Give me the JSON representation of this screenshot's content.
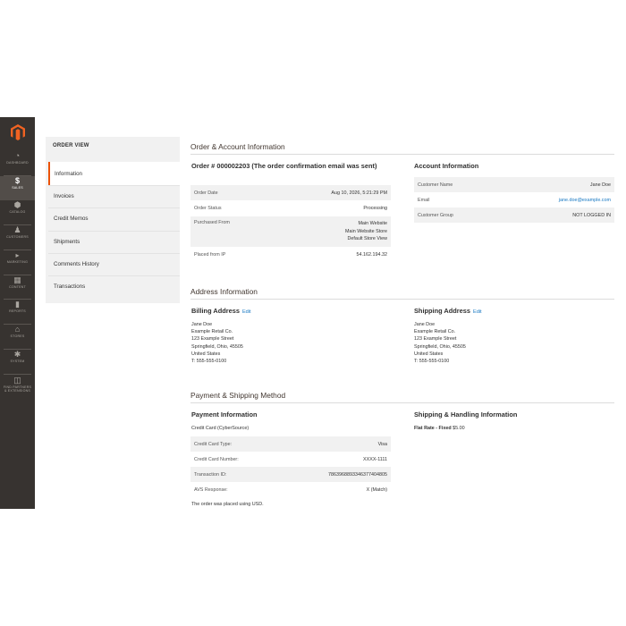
{
  "nav": {
    "items": [
      {
        "label": "DASHBOARD",
        "icon": "dashboard-icon",
        "glyph": "◔"
      },
      {
        "label": "SALES",
        "icon": "dollar-icon",
        "glyph": "$"
      },
      {
        "label": "CATALOG",
        "icon": "cube-icon",
        "glyph": "⬢"
      },
      {
        "label": "CUSTOMERS",
        "icon": "person-icon",
        "glyph": "♟"
      },
      {
        "label": "MARKETING",
        "icon": "megaphone-icon",
        "glyph": "📢"
      },
      {
        "label": "CONTENT",
        "icon": "content-icon",
        "glyph": "▦"
      },
      {
        "label": "REPORTS",
        "icon": "bar-chart-icon",
        "glyph": "▮"
      },
      {
        "label": "STORES",
        "icon": "store-icon",
        "glyph": "⌂"
      },
      {
        "label": "SYSTEM",
        "icon": "gear-icon",
        "glyph": "✱"
      },
      {
        "label": "FIND PARTNERS & EXTENSIONS",
        "icon": "partners-icon",
        "glyph": "◫"
      }
    ]
  },
  "tabs": {
    "title": "ORDER VIEW",
    "items": [
      "Information",
      "Invoices",
      "Credit Memos",
      "Shipments",
      "Comments History",
      "Transactions"
    ]
  },
  "order_account": {
    "heading": "Order & Account Information",
    "order_title": "Order # 000002203 (The order confirmation email was sent)",
    "order_rows": [
      {
        "k": "Order Date",
        "v": "Aug 10, 2026, 5:21:29 PM"
      },
      {
        "k": "Order Status",
        "v": "Processing"
      },
      {
        "k": "Purchased From",
        "v1": "Main Website",
        "v2": "Main Website Store",
        "v3": "Default Store View"
      },
      {
        "k": "Placed from IP",
        "v": "54.162.194.32"
      }
    ],
    "account_title": "Account Information",
    "account_rows": [
      {
        "k": "Customer Name",
        "v": "Jane Doe"
      },
      {
        "k": "Email",
        "v": "jane.doe@example.com"
      },
      {
        "k": "Customer Group",
        "v": "NOT LOGGED IN"
      }
    ]
  },
  "address": {
    "heading": "Address Information",
    "billing_title": "Billing Address",
    "shipping_title": "Shipping Address",
    "edit_label": "Edit",
    "billing_lines": [
      "Jane Doe",
      "Example Retail Co.",
      "123 Example Street",
      "Springfield, Ohio, 45505",
      "United States",
      "T: 555-555-0100"
    ],
    "shipping_lines": [
      "Jane Doe",
      "Example Retail Co.",
      "123 Example Street",
      "Springfield, Ohio, 45505",
      "United States",
      "T: 555-555-0100"
    ]
  },
  "payment": {
    "heading": "Payment & Shipping Method",
    "payment_title": "Payment Information",
    "method": "Credit Card (CyberSource)",
    "rows": [
      {
        "k": "Credit Card Type:",
        "v": "Visa"
      },
      {
        "k": "Credit Card Number:",
        "v": "XXXX-1111"
      },
      {
        "k": "Transaction ID:",
        "v": "7863968893346377404805"
      },
      {
        "k": "AVS Response:",
        "v": "X (Match)"
      }
    ],
    "currency_note": "The order was placed using USD.",
    "shipping_title": "Shipping & Handling Information",
    "shipping_method": "Flat Rate - Fixed",
    "shipping_price": "$5.00"
  },
  "colors": {
    "accent": "#eb5202",
    "link": "#1979c3",
    "nav_bg": "#373330"
  }
}
